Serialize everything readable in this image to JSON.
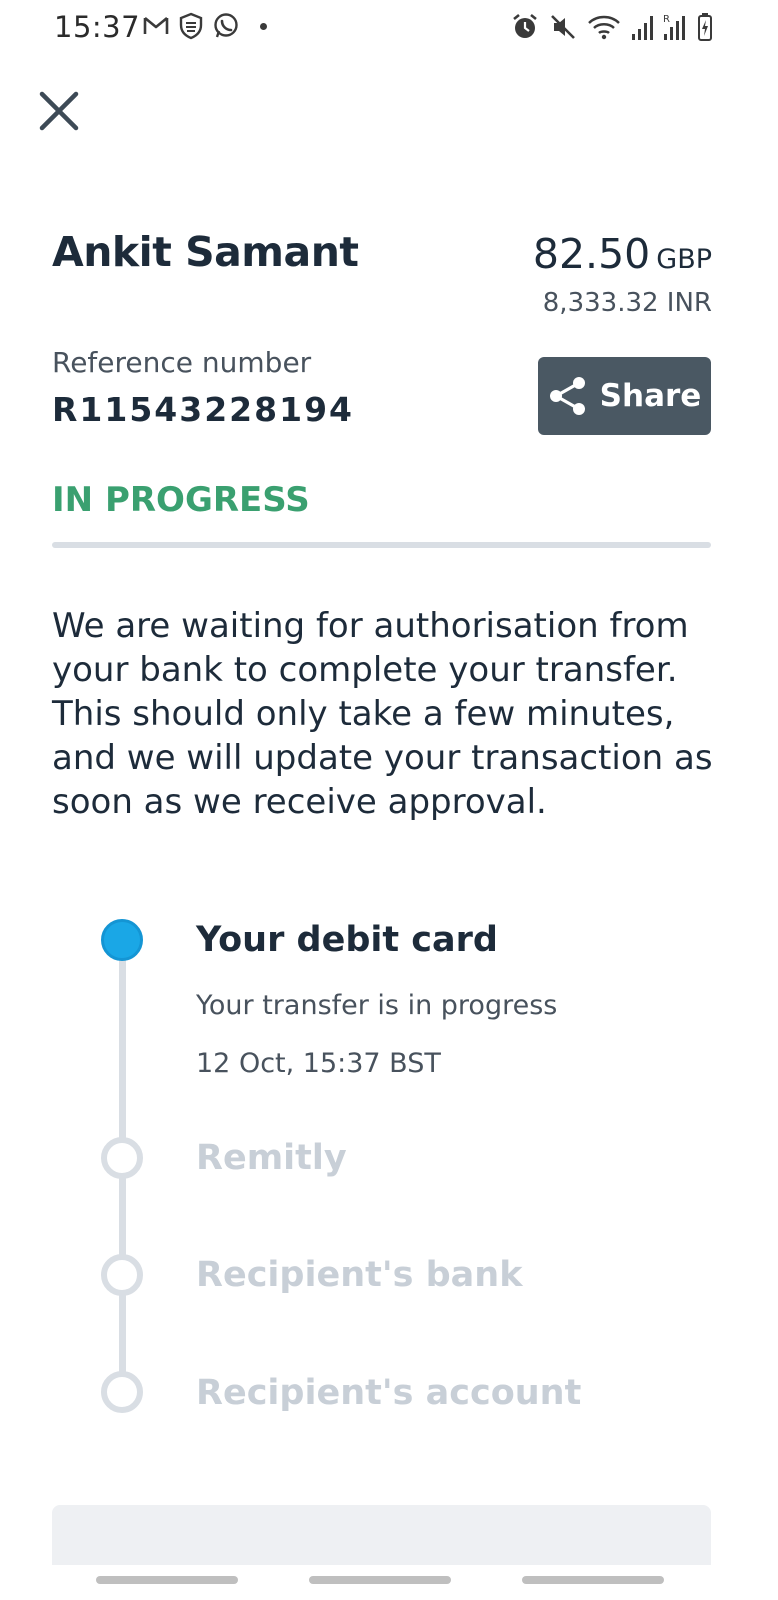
{
  "status_bar": {
    "time": "15:37"
  },
  "transfer": {
    "recipient_name": "Ankit Samant",
    "amount": "82.50",
    "amount_currency": "GBP",
    "converted_amount": "8,333.32 INR",
    "reference_label": "Reference number",
    "reference_number": "R11543228194",
    "share_label": "Share",
    "status": "IN PROGRESS",
    "description": "We are waiting for authorisation from your bank to complete your transfer. This should only take a few minutes, and we will update your transaction as soon as we receive approval."
  },
  "timeline": {
    "steps": [
      {
        "title": "Your debit card",
        "subtitle": "Your transfer is in progress",
        "timestamp": "12 Oct, 15:37 BST",
        "state": "active"
      },
      {
        "title": "Remitly",
        "state": "pending"
      },
      {
        "title": "Recipient's bank",
        "state": "pending"
      },
      {
        "title": "Recipient's account",
        "state": "pending"
      }
    ]
  },
  "colors": {
    "status_green": "#3aa070",
    "active_blue": "#1aa7e6",
    "share_button_bg": "#4a5863",
    "text_dark": "#1d2b3a",
    "pending_text": "#c8cfd7"
  },
  "icons": {
    "status_left": [
      "gmail-icon",
      "shield-icon",
      "whatsapp-icon",
      "notification-dot"
    ],
    "status_right": [
      "alarm-icon",
      "mute-icon",
      "wifi-icon",
      "signal-icon",
      "signal-icon",
      "battery-icon"
    ],
    "close": "close-icon",
    "share": "share-icon"
  }
}
